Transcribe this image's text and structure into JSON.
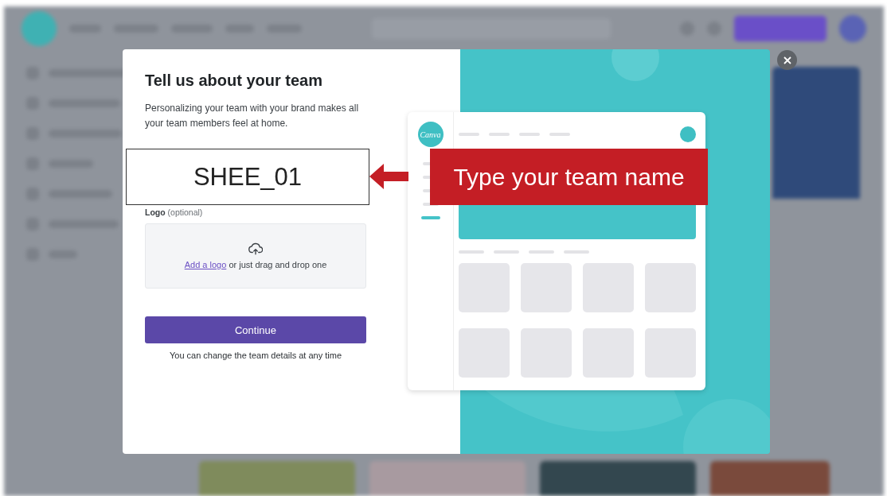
{
  "modal": {
    "title": "Tell us about your team",
    "description": "Personalizing your team with your brand makes all your team members feel at home.",
    "logo_label": "**Logo** (optional)",
    "upload_link": "Add a logo",
    "upload_text": "or just drag and drop one",
    "continue_button": "Continue",
    "footnote": "You can change the team details at any time"
  },
  "preview": {
    "logo": "Canva"
  },
  "annotation": {
    "value": "SHEE_01",
    "callout": "Type your team name"
  }
}
